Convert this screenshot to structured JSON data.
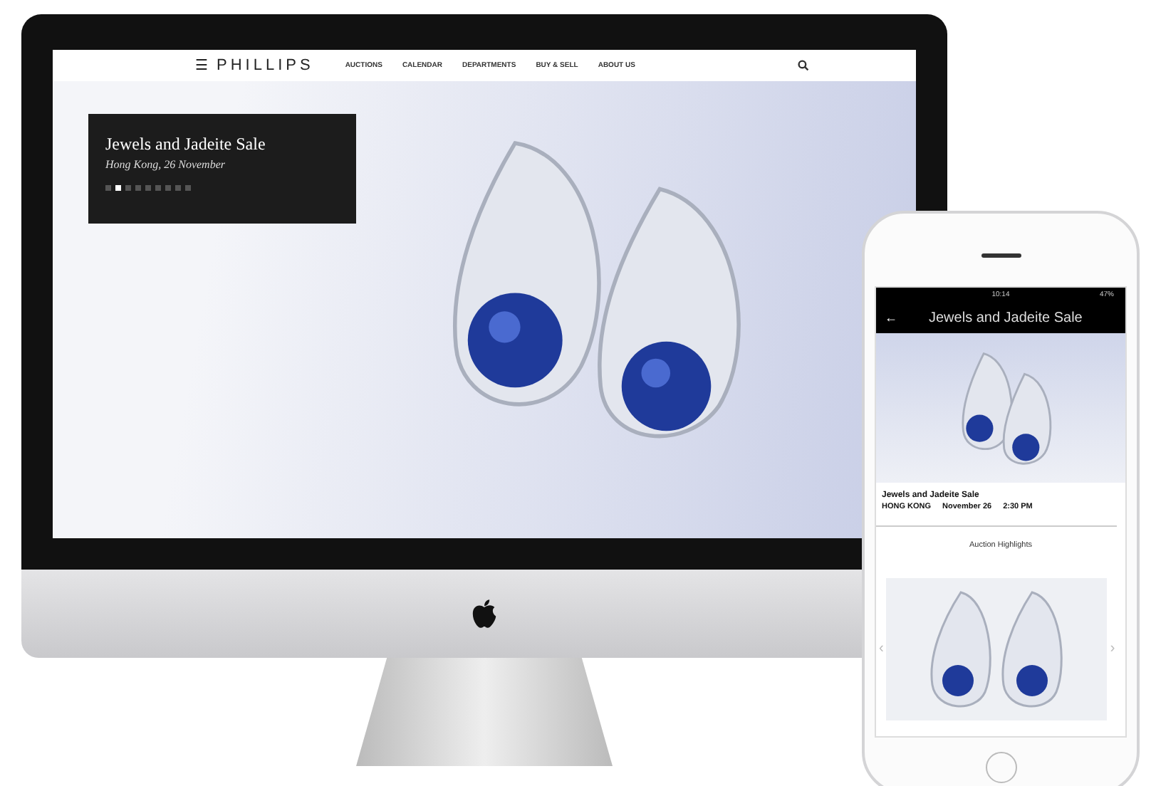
{
  "desktop": {
    "logo": "PHILLIPS",
    "menu_icon": "☰",
    "nav": [
      "AUCTIONS",
      "CALENDAR",
      "DEPARTMENTS",
      "BUY & SELL",
      "ABOUT US"
    ],
    "hero": {
      "title": "Jewels and Jadeite Sale",
      "subtitle": "Hong Kong, 26 November",
      "slides": [
        {
          "selected": false
        },
        {
          "selected": true
        },
        {
          "selected": false
        },
        {
          "selected": false
        },
        {
          "selected": false
        },
        {
          "selected": false
        },
        {
          "selected": false
        },
        {
          "selected": false
        },
        {
          "selected": false
        }
      ]
    }
  },
  "phone": {
    "status_bar": {
      "time": "10:14",
      "battery": "47%"
    },
    "header": {
      "back": "←",
      "title": "Jewels and Jadeite Sale"
    },
    "sale": {
      "title": "Jewels and Jadeite Sale",
      "location": "HONG KONG",
      "date": "November 26",
      "time": "2:30 PM"
    },
    "section_title": "Auction Highlights",
    "prev": "‹",
    "next": "›"
  }
}
